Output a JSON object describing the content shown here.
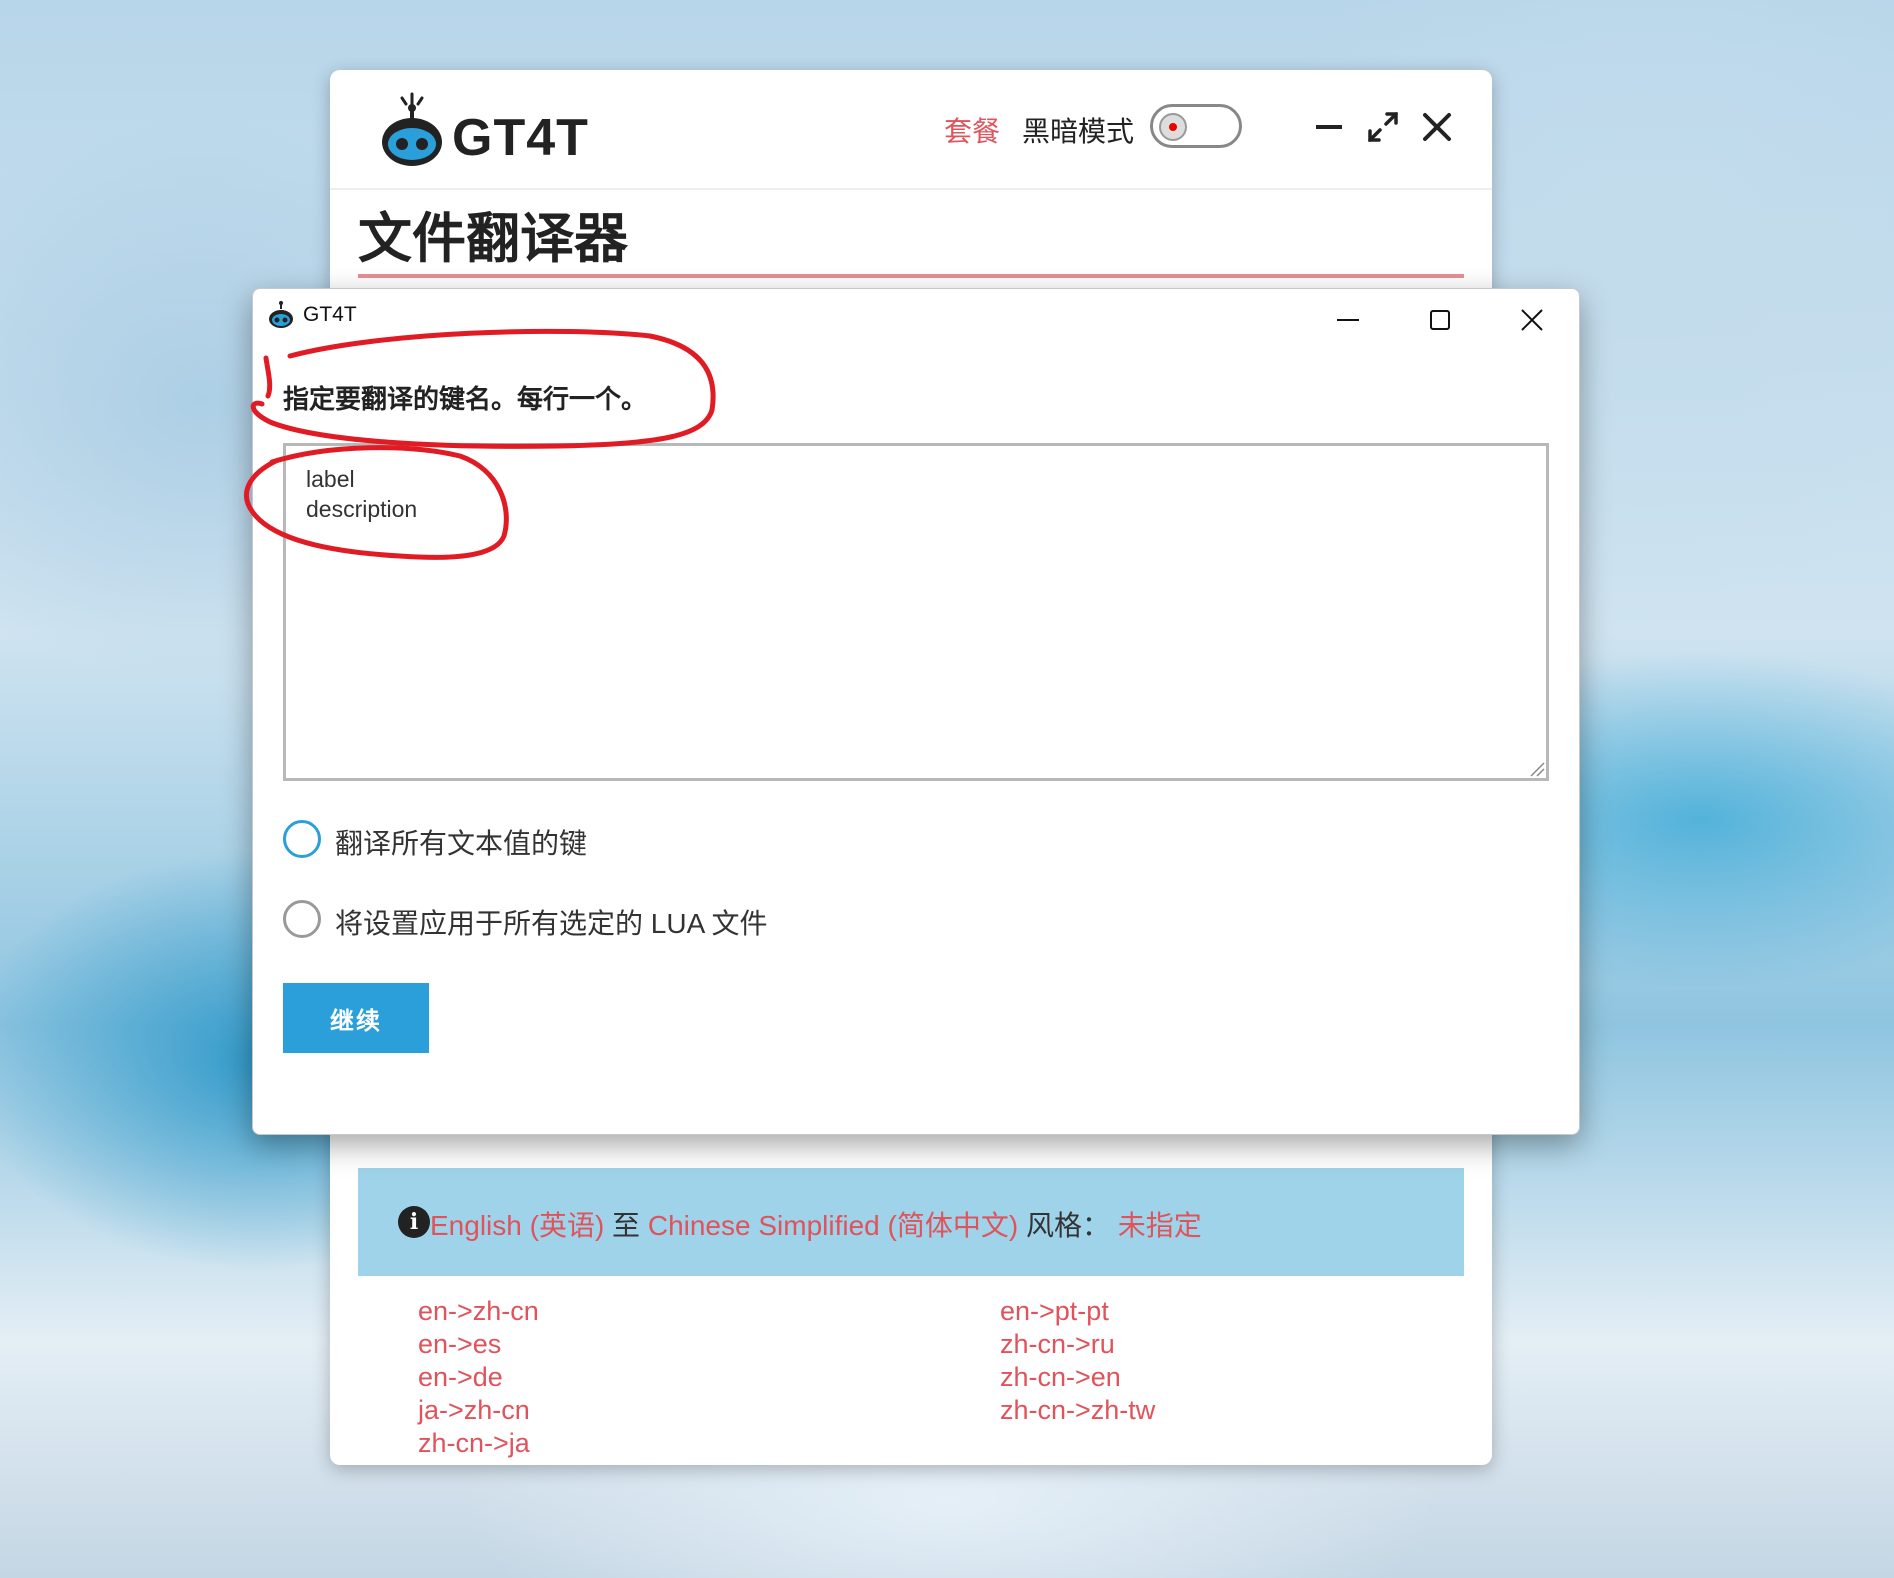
{
  "main_window": {
    "logo_text": "GT4T",
    "plan_link": "套餐",
    "dark_mode_label": "黑暗模式",
    "dark_mode_on": false,
    "page_title": "文件翻译器",
    "info": {
      "source_lang": "English (英语)",
      "to_word": "至",
      "target_lang": "Chinese Simplified (简体中文)",
      "style_label": "风格：",
      "style_value": "未指定"
    },
    "lang_pairs_left": [
      "en->zh-cn",
      "en->es",
      "en->de",
      "ja->zh-cn",
      "zh-cn->ja"
    ],
    "lang_pairs_right": [
      "en->pt-pt",
      "zh-cn->ru",
      "zh-cn->en",
      "zh-cn->zh-tw"
    ]
  },
  "dialog": {
    "title": "GT4T",
    "prompt": "指定要翻译的键名。每行一个。",
    "keys_text": "label\ndescription",
    "options": [
      {
        "label": "翻译所有文本值的键",
        "focused": true
      },
      {
        "label": "将设置应用于所有选定的 LUA 文件",
        "focused": false
      }
    ],
    "continue_button": "继续"
  },
  "colors": {
    "accent_red": "#e0535b",
    "button_blue": "#2b9fd9",
    "info_bg": "#9fd3ea",
    "annotation_red": "#e01b24"
  }
}
